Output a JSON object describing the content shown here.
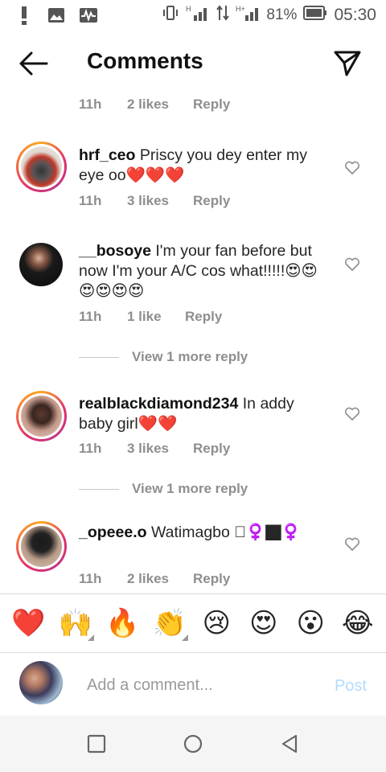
{
  "status_bar": {
    "battery_percent": "81%",
    "time": "05:30",
    "network_labels": [
      "H",
      "H+"
    ]
  },
  "header": {
    "title": "Comments"
  },
  "comments": [
    {
      "user": "",
      "text": "",
      "time": "11h",
      "likes": "2 likes",
      "reply": "Reply"
    },
    {
      "user": "hrf_ceo",
      "text": " Priscy you dey enter my eye oo❤️❤️❤️",
      "time": "11h",
      "likes": "3 likes",
      "reply": "Reply"
    },
    {
      "user": "__bosoye",
      "text": " I'm your fan before but now I'm your A/C cos what!!!!!😍😍😍😍😍😍",
      "time": "11h",
      "likes": "1 like",
      "reply": "Reply",
      "view_more": "View 1 more reply"
    },
    {
      "user": "realblackdiamond234",
      "text": " In addy baby girl❤️❤️",
      "time": "11h",
      "likes": "3 likes",
      "reply": "Reply",
      "view_more": "View 1 more reply"
    },
    {
      "user": "_opeee.o",
      "text": " Watimagbo 🏿‍♀️🏿‍♀️",
      "time": "11h",
      "likes": "2 likes",
      "reply": "Reply"
    }
  ],
  "emoji_bar": [
    "❤️",
    "🙌",
    "🔥",
    "👏",
    "😢",
    "😍",
    "😮",
    "😂"
  ],
  "add_comment": {
    "placeholder": "Add a comment...",
    "post_label": "Post"
  },
  "colors": {
    "accent_post_disabled": "#b3dbff",
    "meta_gray": "#8e8e8e",
    "story_ring": "#e1306c"
  }
}
